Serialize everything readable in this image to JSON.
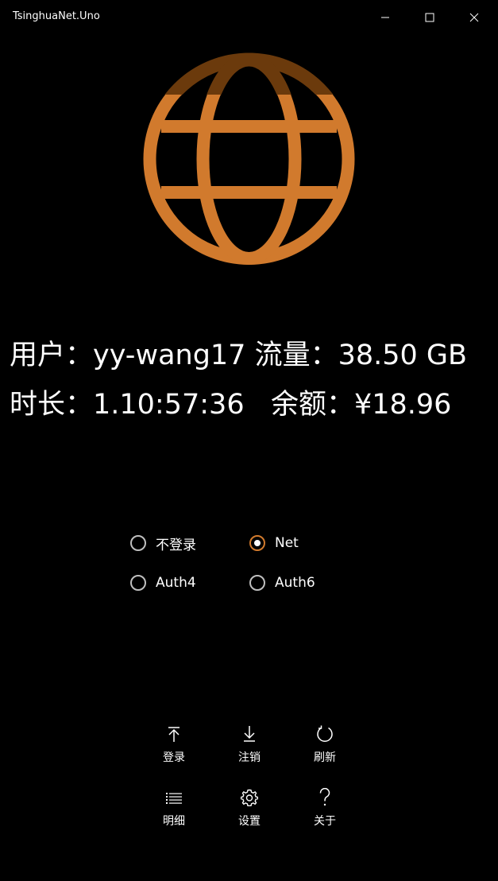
{
  "window": {
    "title": "TsinghuaNet.Uno"
  },
  "caption_icons": [
    "minimize-icon",
    "maximize-icon",
    "close-icon"
  ],
  "accent_color": "#d17a2d",
  "globe_icon": "globe-icon",
  "info": {
    "line1": "用户：yy-wang17 流量：38.50 GB",
    "line2": "时长：1.10:57:36   余额：¥18.96"
  },
  "modes": [
    {
      "label": "不登录",
      "checked": false
    },
    {
      "label": "Net",
      "checked": true
    },
    {
      "label": "Auth4",
      "checked": false
    },
    {
      "label": "Auth6",
      "checked": false
    }
  ],
  "commands": [
    {
      "label": "登录",
      "icon": "upload-arrow-icon"
    },
    {
      "label": "注销",
      "icon": "download-arrow-icon"
    },
    {
      "label": "刷新",
      "icon": "refresh-icon"
    },
    {
      "label": "明细",
      "icon": "list-icon"
    },
    {
      "label": "设置",
      "icon": "gear-icon"
    },
    {
      "label": "关于",
      "icon": "question-icon"
    }
  ]
}
